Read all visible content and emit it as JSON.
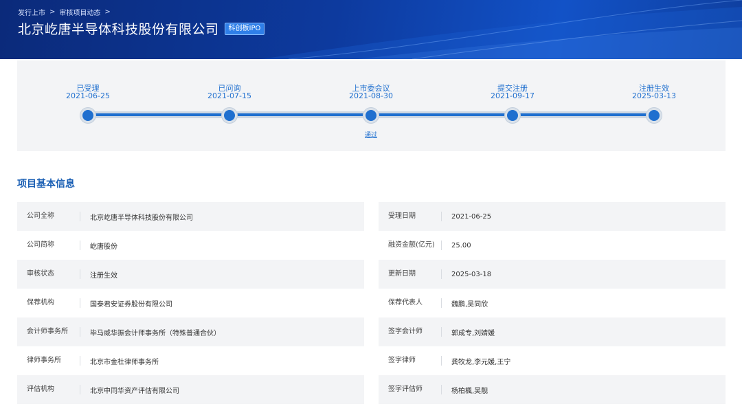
{
  "header": {
    "breadcrumb": [
      "发行上市",
      "审核项目动态"
    ],
    "title": "北京屹唐半导体科技股份有限公司",
    "badge": "科创板IPO"
  },
  "timeline": {
    "steps": [
      {
        "label": "已受理",
        "date": "2021-06-25",
        "note": ""
      },
      {
        "label": "已问询",
        "date": "2021-07-15",
        "note": ""
      },
      {
        "label": "上市委会议",
        "date": "2021-08-30",
        "note": "通过"
      },
      {
        "label": "提交注册",
        "date": "2021-09-17",
        "note": ""
      },
      {
        "label": "注册生效",
        "date": "2025-03-13",
        "note": ""
      }
    ]
  },
  "section": {
    "title": "项目基本信息"
  },
  "info": {
    "left": [
      {
        "key": "公司全称",
        "value": "北京屹唐半导体科技股份有限公司"
      },
      {
        "key": "公司简称",
        "value": "屹唐股份"
      },
      {
        "key": "审核状态",
        "value": "注册生效"
      },
      {
        "key": "保荐机构",
        "value": "国泰君安证券股份有限公司"
      },
      {
        "key": "会计师事务所",
        "value": "毕马威华振会计师事务所（特殊普通合伙）"
      },
      {
        "key": "律师事务所",
        "value": "北京市金杜律师事务所"
      },
      {
        "key": "评估机构",
        "value": "北京中同华资产评估有限公司"
      }
    ],
    "right": [
      {
        "key": "受理日期",
        "value": "2021-06-25"
      },
      {
        "key": "融资金额(亿元)",
        "value": "25.00"
      },
      {
        "key": "更新日期",
        "value": "2025-03-18"
      },
      {
        "key": "保荐代表人",
        "value": "魏鹏,吴同欣"
      },
      {
        "key": "签字会计师",
        "value": "郭成专,刘婧媛"
      },
      {
        "key": "签字律师",
        "value": "龚牧龙,李元媛,王宁"
      },
      {
        "key": "签字评估师",
        "value": "杨柏楓,吴靓"
      }
    ]
  },
  "colors": {
    "accent": "#1f6fcf",
    "banner": "#0d3a9e",
    "row_bg": "#f3f4f6"
  }
}
